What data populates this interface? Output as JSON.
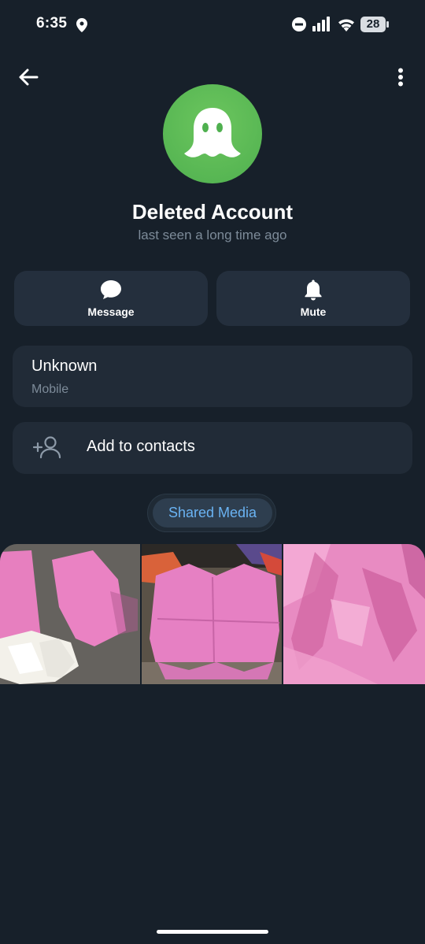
{
  "status_bar": {
    "time": "6:35",
    "battery": "28",
    "icons": [
      "location-icon",
      "dnd-icon",
      "signal-icon",
      "wifi-icon",
      "battery-icon"
    ]
  },
  "top_bar": {
    "back_icon": "arrow-left-icon",
    "menu_icon": "more-vertical-icon"
  },
  "profile": {
    "avatar_icon": "ghost-icon",
    "avatar_color": "#5cb85c",
    "name": "Deleted Account",
    "status": "last seen a long time ago"
  },
  "actions": {
    "message_label": "Message",
    "mute_label": "Mute"
  },
  "info": {
    "phone_value": "Unknown",
    "phone_label": "Mobile"
  },
  "add_contact": {
    "label": "Add to contacts"
  },
  "shared_media": {
    "label": "Shared Media",
    "accent": "#6ab3f3"
  },
  "theme": {
    "background": "#17202a",
    "card": "#242f3d"
  }
}
